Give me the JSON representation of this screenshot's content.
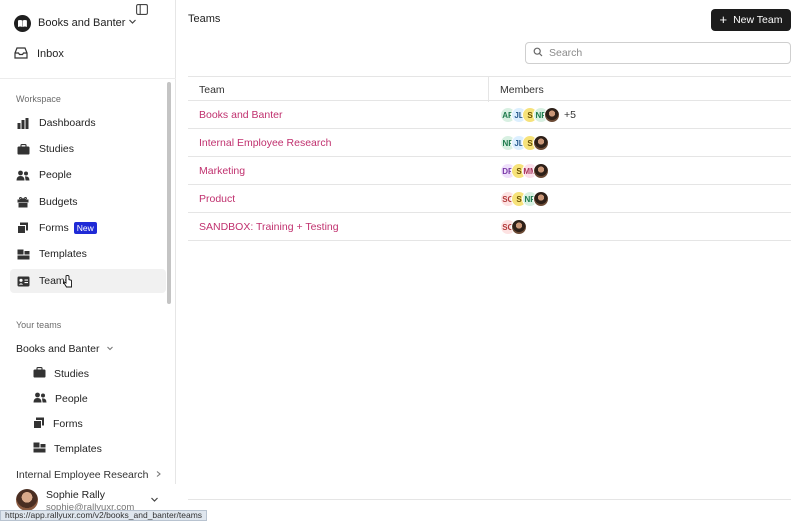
{
  "sidebar": {
    "org_name": "Books and Banter",
    "inbox_label": "Inbox",
    "workspace_label": "Workspace",
    "nav": [
      {
        "label": "Dashboards",
        "icon": "bar-chart-icon"
      },
      {
        "label": "Studies",
        "icon": "briefcase-icon"
      },
      {
        "label": "People",
        "icon": "people-icon"
      },
      {
        "label": "Budgets",
        "icon": "gift-icon"
      },
      {
        "label": "Forms",
        "icon": "forms-icon",
        "badge": "New"
      },
      {
        "label": "Templates",
        "icon": "templates-icon"
      },
      {
        "label": "Teams",
        "icon": "id-card-icon",
        "active": true
      }
    ],
    "your_teams_label": "Your teams",
    "team_name": "Books and Banter",
    "team_items": [
      {
        "label": "Studies"
      },
      {
        "label": "People"
      },
      {
        "label": "Forms"
      },
      {
        "label": "Templates"
      }
    ],
    "next_team": "Internal Employee Research",
    "user": {
      "name": "Sophie Rally",
      "email": "sophie@rallyuxr.com"
    }
  },
  "status_url": "https://app.rallyuxr.com/v2/books_and_banter/teams",
  "header": {
    "title": "Teams",
    "new_team_label": "New Team"
  },
  "search": {
    "placeholder": "Search"
  },
  "table": {
    "columns": [
      "Team",
      "Members"
    ],
    "rows": [
      {
        "name": "Books and Banter",
        "members": [
          "AR",
          "JL",
          "S",
          "NP"
        ],
        "more": "+5"
      },
      {
        "name": "Internal Employee Research",
        "members": [
          "NP",
          "JL",
          "S"
        ],
        "more": ""
      },
      {
        "name": "Marketing",
        "members": [
          "DR",
          "S",
          "MM"
        ],
        "more": ""
      },
      {
        "name": "Product",
        "members": [
          "SO",
          "S",
          "NP"
        ],
        "more": ""
      },
      {
        "name": "SANDBOX: Training + Testing",
        "members": [
          "SO"
        ],
        "more": ""
      }
    ]
  },
  "colors": {
    "accent": "#c0306e",
    "badge_new": "#1f2ad6",
    "primary_button": "#1c1c1c",
    "avatar_AR": "#d8f0e2",
    "avatar_JL": "#dcefff",
    "avatar_S": "#f6e27a",
    "avatar_NP": "#d8f0e2",
    "avatar_DR": "#efe0fb",
    "avatar_MM": "#fbe0ea",
    "avatar_SO": "#fde2e2"
  }
}
